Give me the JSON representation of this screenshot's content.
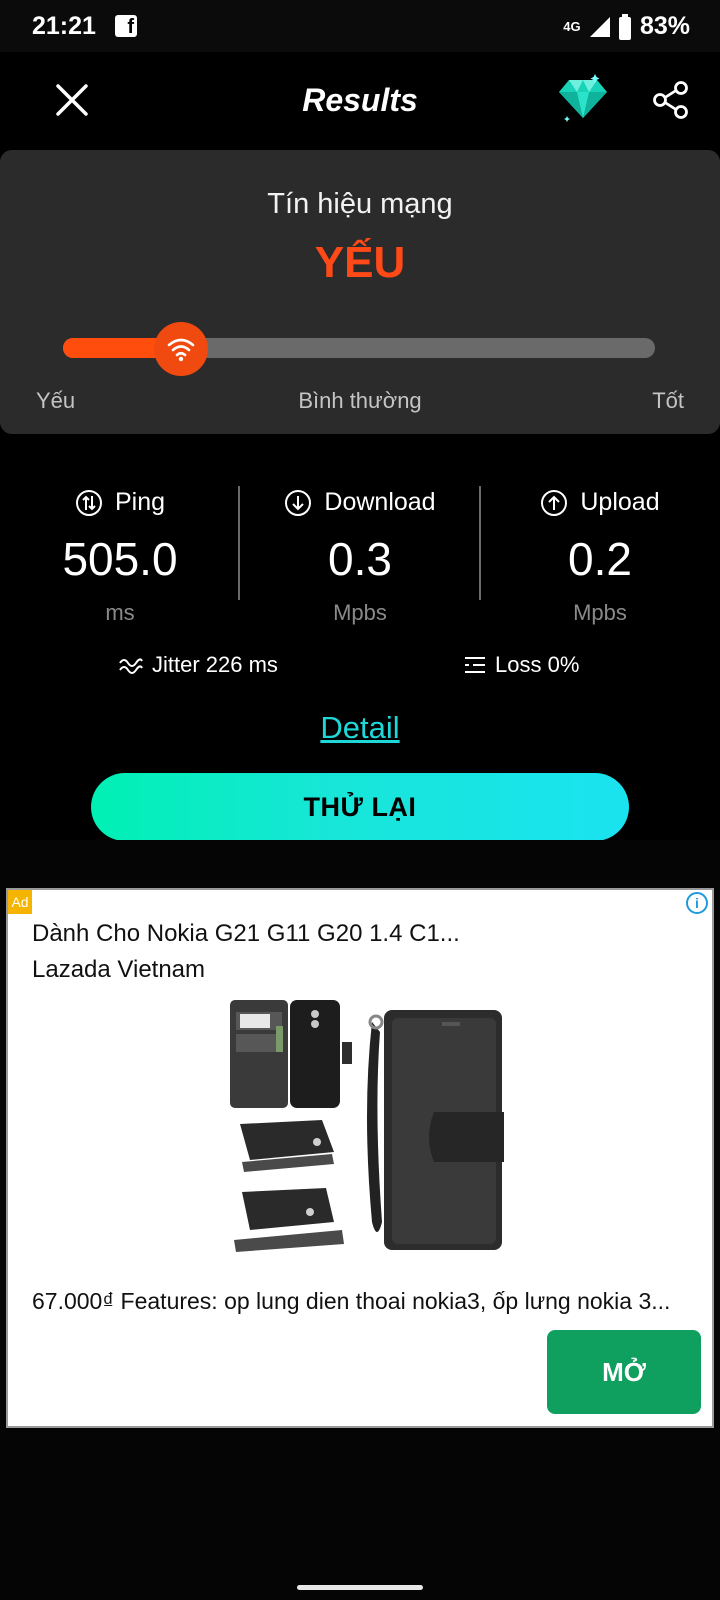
{
  "status_bar": {
    "time": "21:21",
    "network": "4G",
    "battery": "83%"
  },
  "header": {
    "title": "Results"
  },
  "signal": {
    "title": "Tín hiệu mạng",
    "status": "YẾU",
    "level_fraction": 0.2,
    "labels": {
      "weak": "Yếu",
      "normal": "Bình thường",
      "good": "Tốt"
    }
  },
  "metrics": [
    {
      "label": "Ping",
      "value": "505.0",
      "unit": "ms"
    },
    {
      "label": "Download",
      "value": "0.3",
      "unit": "Mpbs"
    },
    {
      "label": "Upload",
      "value": "0.2",
      "unit": "Mpbs"
    }
  ],
  "jitter": "Jitter 226 ms",
  "loss": "Loss 0%",
  "detail_link": "Detail",
  "retry_button": "THỬ LẠI",
  "ad": {
    "badge": "Ad",
    "headline": "Dành Cho Nokia G21 G11 G20 1.4 C1...",
    "advertiser": "Lazada Vietnam",
    "description": "67.000₫ Features: op lung dien thoai nokia3, ốp lưng nokia 3...",
    "cta": "MỞ"
  },
  "colors": {
    "accent_orange": "#ff4d0d",
    "accent_cyan": "#1ed8d8",
    "cta_green": "#0f9f5f"
  }
}
